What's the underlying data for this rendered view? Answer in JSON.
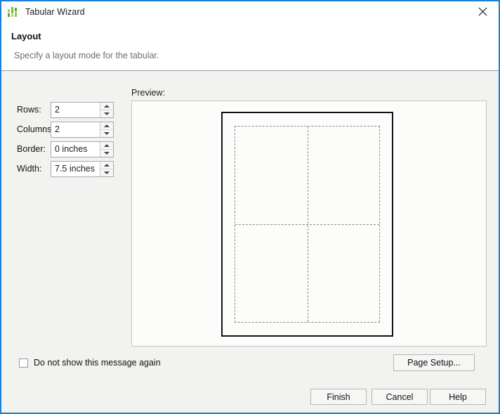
{
  "window": {
    "title": "Tabular Wizard",
    "icon": "bar-chart-icon",
    "close_label": "×",
    "accent_color": "#1c7fd4"
  },
  "header": {
    "title": "Layout",
    "subtitle": "Specify a layout mode for the tabular."
  },
  "form": {
    "fields": [
      {
        "label": "Rows:",
        "value": "2"
      },
      {
        "label": "Columns:",
        "value": "2"
      },
      {
        "label": "Border:",
        "value": "0 inches"
      },
      {
        "label": "Width:",
        "value": "7.5 inches"
      }
    ]
  },
  "preview": {
    "label": "Preview:",
    "rows": 2,
    "columns": 2
  },
  "options": {
    "do_not_show_label": "Do not show this message again",
    "do_not_show_checked": false
  },
  "buttons": {
    "page_setup": "Page Setup...",
    "finish": "Finish",
    "cancel": "Cancel",
    "help": "Help"
  }
}
